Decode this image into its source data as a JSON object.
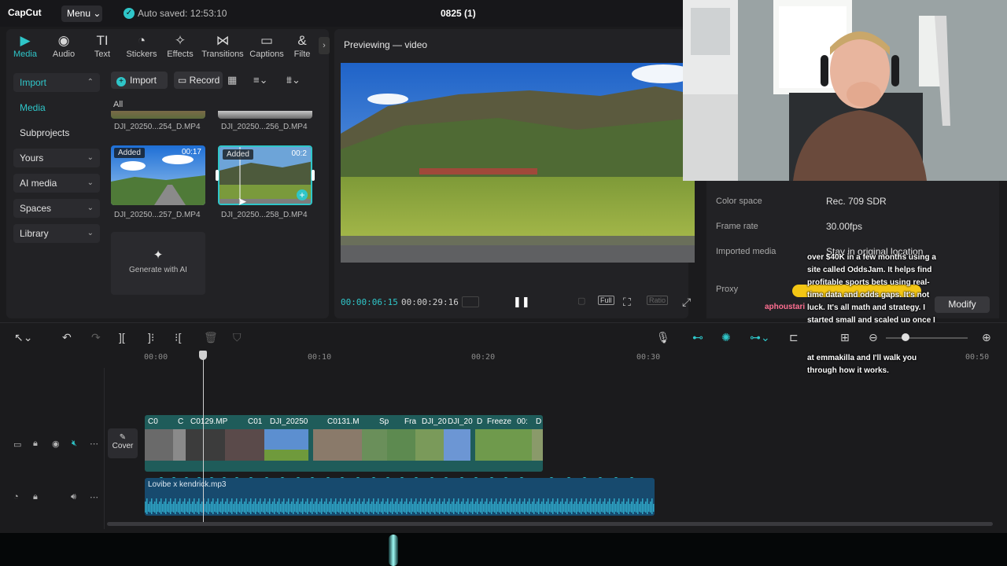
{
  "app": {
    "logo": "CapCut",
    "menu_label": "Menu ⌄",
    "autosave": "Auto saved: 12:53:10",
    "project_title": "0825 (1)"
  },
  "tabs": [
    {
      "label": "Media",
      "icon": "media-icon",
      "glyph": "▶",
      "active": true
    },
    {
      "label": "Audio",
      "icon": "audio-icon",
      "glyph": "◉"
    },
    {
      "label": "Text",
      "icon": "text-icon",
      "glyph": "TI"
    },
    {
      "label": "Stickers",
      "icon": "stickers-icon",
      "glyph": "◔"
    },
    {
      "label": "Effects",
      "icon": "effects-icon",
      "glyph": "✧"
    },
    {
      "label": "Transitions",
      "icon": "transitions-icon",
      "glyph": "⋈"
    },
    {
      "label": "Captions",
      "icon": "captions-icon",
      "glyph": "▭"
    },
    {
      "label": "Filte",
      "icon": "filters-icon",
      "glyph": "&"
    }
  ],
  "sidebar": {
    "import": "Import",
    "media": "Media",
    "subprojects": "Subprojects",
    "yours": "Yours",
    "ai_media": "AI media",
    "spaces": "Spaces",
    "library": "Library"
  },
  "media_toolbar": {
    "import_label": "Import",
    "record_label": "Record",
    "filter_all": "All"
  },
  "media_items": [
    {
      "name": "DJI_20250...254_D.MP4"
    },
    {
      "name": "DJI_20250...256_D.MP4"
    },
    {
      "name": "DJI_20250...257_D.MP4",
      "badge": "Added",
      "duration": "00:17"
    },
    {
      "name": "DJI_20250...258_D.MP4",
      "badge": "Added",
      "duration": "00:2"
    }
  ],
  "generate_ai": "Generate with AI",
  "preview": {
    "title": "Previewing — video",
    "current_time": "00:00:06:15",
    "total_time": "00:00:29:16",
    "full_label": "Full",
    "ratio_label": "Ratio"
  },
  "properties": {
    "rows": [
      {
        "label": "Color space",
        "value": "Rec. 709 SDR"
      },
      {
        "label": "Frame rate",
        "value": "30.00fps"
      },
      {
        "label": "Imported media",
        "value": "Stay in original location"
      },
      {
        "label": "Proxy",
        "value": ""
      }
    ],
    "modify_label": "Modify"
  },
  "chat": {
    "user1": "aphoustari",
    "user2": "aphoustari",
    "message": "over $40K in a few months using a site called OddsJam. It helps find profitable sports bets using real-time data and odds gaps. It's not luck. It's all math and strategy. I started small and scaled up once I got the hang of it. If you are interested, message me on Discord at emmakilla and I'll walk you through how it works."
  },
  "ruler": [
    "00:00",
    "00:10",
    "00:20",
    "00:30",
    "00:50"
  ],
  "timeline": {
    "cover_label": "Cover",
    "clips": [
      "C0",
      "C",
      "C0129.MP",
      "C01",
      "DJI_20250",
      "C0131.M",
      "Sp",
      "Fra",
      "DJI_20",
      "DJI_20",
      "D",
      "Freeze",
      "00:",
      "D"
    ],
    "audio_name": "Lovibe x kendrick.mp3"
  },
  "colors": {
    "accent": "#2fc6c9",
    "video_track": "#1f5c5a",
    "audio_track": "#174a6e",
    "chat_name": "#ff6f91",
    "highlight": "#f3c614"
  }
}
